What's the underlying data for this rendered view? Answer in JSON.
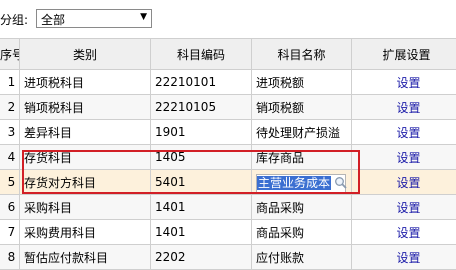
{
  "filter": {
    "label": "分组:",
    "selected": "全部"
  },
  "columns": [
    "序号",
    "类别",
    "科目编码",
    "科目名称",
    "扩展设置"
  ],
  "rows": [
    {
      "no": "1",
      "category": "进项税科目",
      "code": "22210101",
      "name": "进项税额",
      "action": "设置"
    },
    {
      "no": "2",
      "category": "销项税科目",
      "code": "22210105",
      "name": "销项税额",
      "action": "设置"
    },
    {
      "no": "3",
      "category": "差异科目",
      "code": "1901",
      "name": "待处理财产损溢",
      "action": "设置"
    },
    {
      "no": "4",
      "category": "存货科目",
      "code": "1405",
      "name": "库存商品",
      "action": "设置"
    },
    {
      "no": "5",
      "category": "存货对方科目",
      "code": "5401",
      "name": "主营业务成本",
      "action": "设置"
    },
    {
      "no": "6",
      "category": "采购科目",
      "code": "1401",
      "name": "商品采购",
      "action": "设置"
    },
    {
      "no": "7",
      "category": "采购费用科目",
      "code": "1401",
      "name": "商品采购",
      "action": "设置"
    },
    {
      "no": "8",
      "category": "暂估应付款科目",
      "code": "2202",
      "name": "应付账款",
      "action": "设置"
    }
  ],
  "colors": {
    "highlight": "#d21f26",
    "link": "#1a1aa8",
    "selection": "#3b6fd1"
  },
  "icons": {
    "lookup": "magnifier-icon",
    "dropdown": "chevron-down-icon"
  }
}
